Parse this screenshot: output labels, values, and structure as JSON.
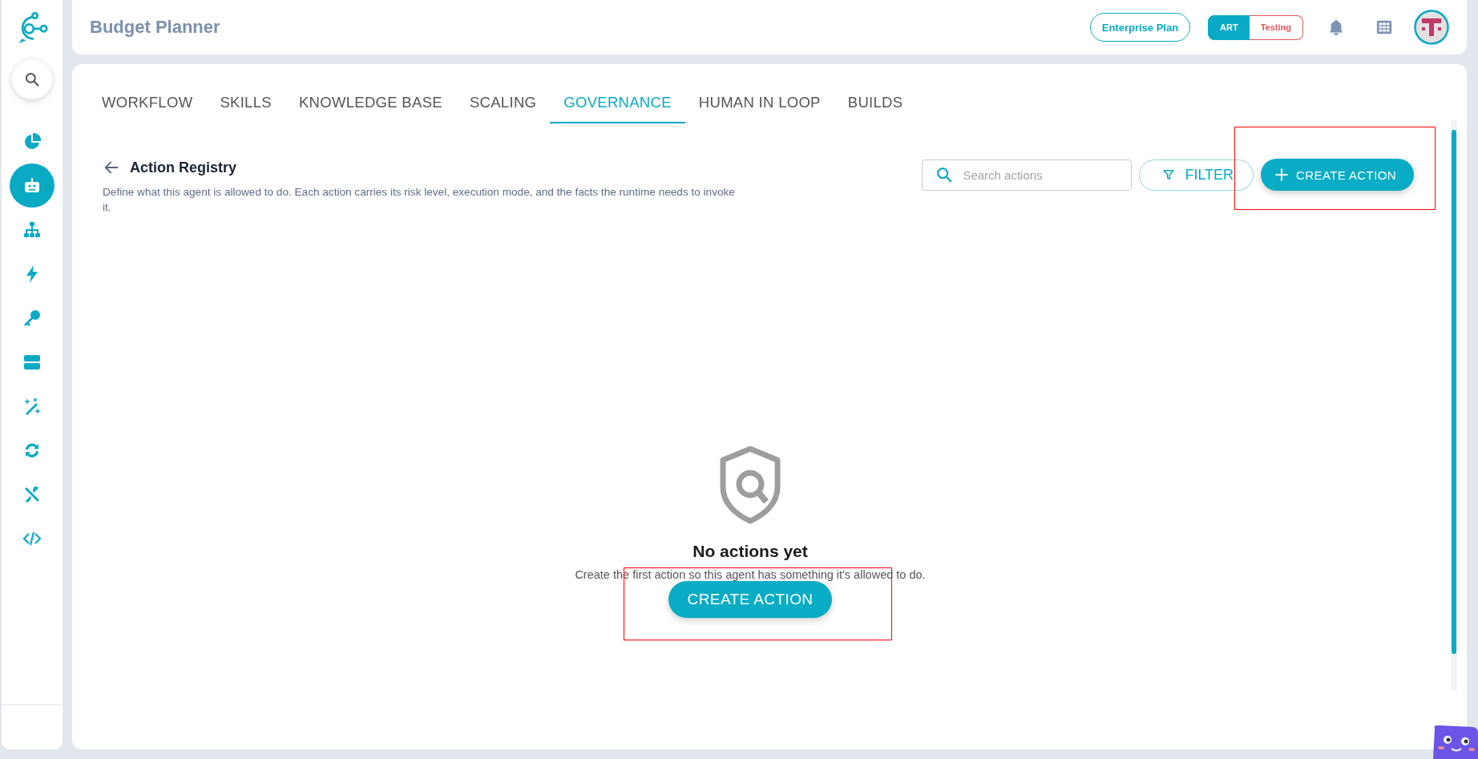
{
  "sidebar": {
    "items": [
      {
        "kind": "chart",
        "selected": false
      },
      {
        "kind": "robot",
        "selected": true
      },
      {
        "kind": "hierarchy",
        "selected": false
      },
      {
        "kind": "bolt",
        "selected": false
      },
      {
        "kind": "key",
        "selected": false
      },
      {
        "kind": "server",
        "selected": false
      },
      {
        "kind": "wand",
        "selected": false
      },
      {
        "kind": "sync",
        "selected": false
      },
      {
        "kind": "tools",
        "selected": false
      },
      {
        "kind": "code",
        "selected": false
      }
    ]
  },
  "header": {
    "title": "Budget Planner",
    "plan": "Enterprise Plan",
    "env_toggle": [
      {
        "label": "ART",
        "selected": true
      },
      {
        "label": "Testing",
        "selected": false
      }
    ]
  },
  "tabs": [
    {
      "label": "WORKFLOW",
      "selected": false
    },
    {
      "label": "SKILLS",
      "selected": false
    },
    {
      "label": "KNOWLEDGE BASE",
      "selected": false
    },
    {
      "label": "SCALING",
      "selected": false
    },
    {
      "label": "GOVERNANCE",
      "selected": true
    },
    {
      "label": "HUMAN IN LOOP",
      "selected": false
    },
    {
      "label": "BUILDS",
      "selected": false
    }
  ],
  "page": {
    "title": "Action Registry",
    "description": "Define what this agent is allowed to do. Each action carries its risk level, execution mode, and the facts the runtime needs to invoke it.",
    "search": {
      "placeholder": "Search actions"
    },
    "filter_button": "FILTER",
    "create_button": "CREATE ACTION"
  },
  "empty_state": {
    "title": "No actions yet",
    "message": "Create the first action so this agent has something it's allowed to do.",
    "button": "CREATE ACTION"
  }
}
